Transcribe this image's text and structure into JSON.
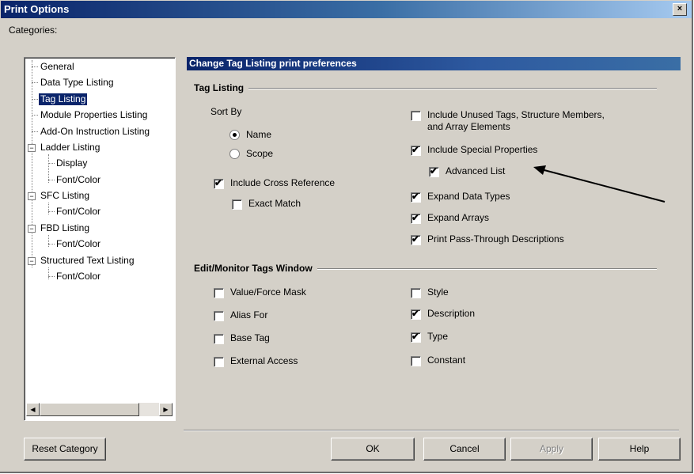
{
  "window": {
    "title": "Print Options",
    "close_label": "×"
  },
  "categories_label": "Categories:",
  "tree": {
    "items": [
      {
        "label": "General"
      },
      {
        "label": "Data Type Listing"
      },
      {
        "label": "Tag Listing",
        "selected": true
      },
      {
        "label": "Module Properties Listing"
      },
      {
        "label": "Add-On Instruction Listing"
      },
      {
        "label": "Ladder Listing"
      },
      {
        "label": "Display"
      },
      {
        "label": "Font/Color"
      },
      {
        "label": "SFC Listing"
      },
      {
        "label": "Font/Color"
      },
      {
        "label": "FBD Listing"
      },
      {
        "label": "Font/Color"
      },
      {
        "label": "Structured Text Listing"
      },
      {
        "label": "Font/Color"
      }
    ],
    "expand_toggle": "−"
  },
  "panel": {
    "header": "Change Tag Listing print preferences",
    "tag_listing": {
      "title": "Tag Listing",
      "sort_by_label": "Sort By",
      "sort_name": "Name",
      "sort_scope": "Scope",
      "sort_selected": "Name",
      "include_cross_reference": {
        "label": "Include Cross Reference",
        "checked": true
      },
      "exact_match": {
        "label": "Exact Match",
        "checked": false
      },
      "include_unused_line1": "Include Unused Tags, Structure Members,",
      "include_unused_line2": "and Array Elements",
      "include_unused_checked": false,
      "include_special": {
        "label": "Include Special Properties",
        "checked": true
      },
      "advanced_list": {
        "label": "Advanced List",
        "checked": true
      },
      "expand_data_types": {
        "label": "Expand Data Types",
        "checked": true
      },
      "expand_arrays": {
        "label": "Expand Arrays",
        "checked": true
      },
      "print_pass_through": {
        "label": "Print Pass-Through Descriptions",
        "checked": true
      }
    },
    "edit_monitor": {
      "title": "Edit/Monitor Tags Window",
      "value_force_mask": {
        "label": "Value/Force Mask",
        "checked": false
      },
      "alias_for": {
        "label": "Alias For",
        "checked": false
      },
      "base_tag": {
        "label": "Base Tag",
        "checked": false
      },
      "external_access": {
        "label": "External Access",
        "checked": false
      },
      "style": {
        "label": "Style",
        "checked": false
      },
      "description": {
        "label": "Description",
        "checked": true
      },
      "type": {
        "label": "Type",
        "checked": true
      },
      "constant": {
        "label": "Constant",
        "checked": false
      }
    }
  },
  "buttons": {
    "reset_category": "Reset Category",
    "ok": "OK",
    "cancel": "Cancel",
    "apply": "Apply",
    "help": "Help"
  },
  "scroll": {
    "left_arrow": "◀",
    "right_arrow": "▶"
  },
  "check_mark": "✔",
  "colors": {
    "dialog_bg": "#d4d0c8",
    "selection": "#0a246a",
    "title_gradient_start": "#0a246a"
  }
}
